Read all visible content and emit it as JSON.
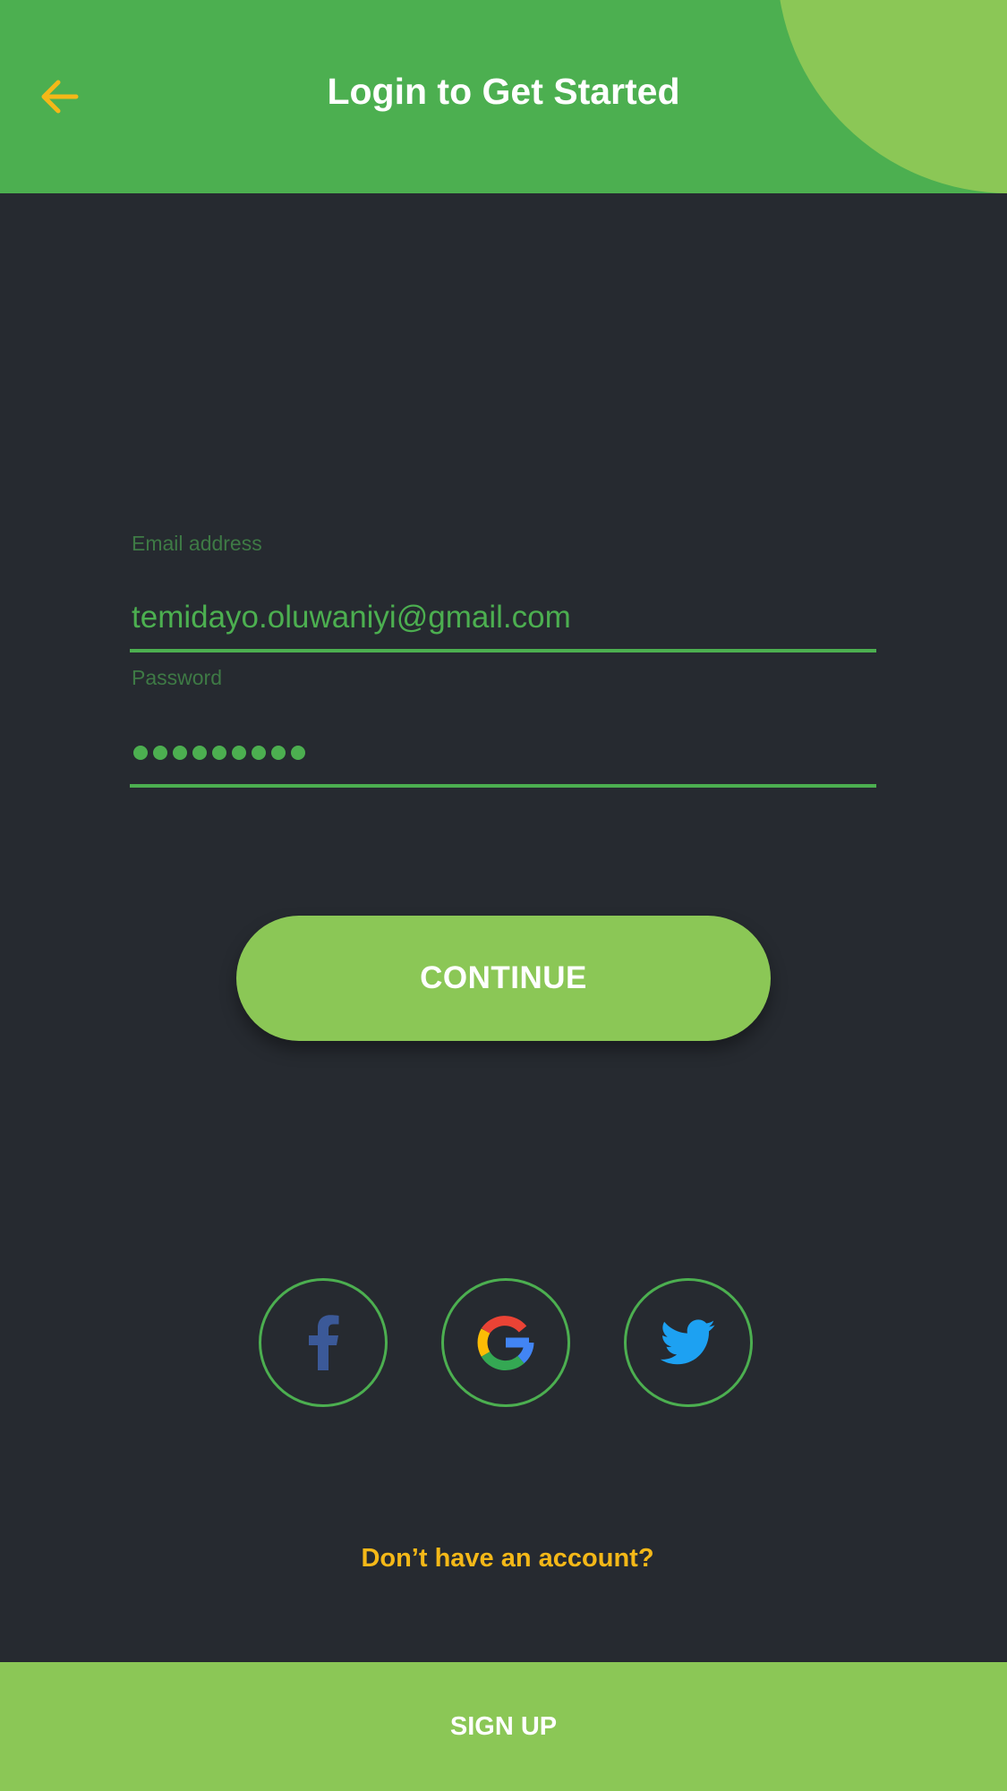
{
  "header": {
    "title": "Login to Get Started",
    "back_icon": "arrow-left-icon"
  },
  "form": {
    "email_label": "Email address",
    "email_value": "temidayo.oluwaniyi@gmail.com",
    "password_label": "Password",
    "password_masked_length": 9
  },
  "actions": {
    "continue_label": "CONTINUE",
    "no_account_label": "Don’t have an account?",
    "signup_label": "SIGN UP"
  },
  "social": [
    {
      "name": "facebook",
      "icon": "facebook-icon"
    },
    {
      "name": "google",
      "icon": "google-icon"
    },
    {
      "name": "twitter",
      "icon": "twitter-icon"
    }
  ],
  "colors": {
    "background": "#262a30",
    "header_green": "#4caf50",
    "accent_light_green": "#8bc756",
    "link_yellow": "#f4b818",
    "facebook_blue": "#3b5998",
    "twitter_blue": "#1da1f2"
  }
}
